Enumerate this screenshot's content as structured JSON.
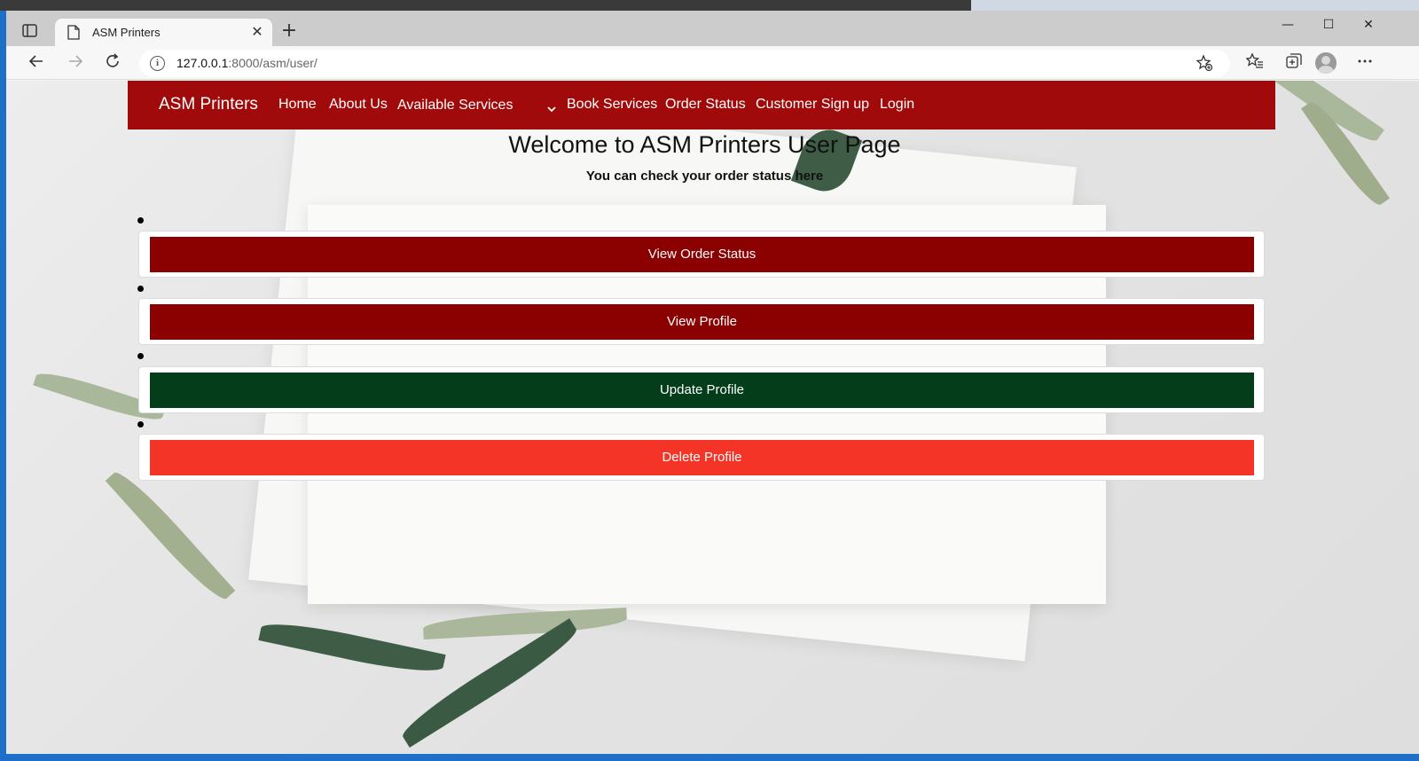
{
  "browser": {
    "tab_title": "ASM Printers",
    "tab_close": "✕",
    "new_tab": "+",
    "url_host": "127.0.0.1",
    "url_rest": ":8000/asm/user/",
    "minimize": "—",
    "maximize": "☐",
    "close": "✕"
  },
  "navbar": {
    "brand": "ASM Printers",
    "links": [
      "Home",
      "About Us",
      "Available Services",
      "Book Services",
      "Order Status",
      "Customer Sign up",
      "Login"
    ],
    "color": "#a10a0a"
  },
  "page": {
    "heading": "Welcome to ASM Printers User Page",
    "subheading": "You can check your order status here"
  },
  "actions": [
    {
      "label": "View Order Status",
      "color": "#8b0000"
    },
    {
      "label": "View Profile",
      "color": "#8b0000"
    },
    {
      "label": "Update Profile",
      "color": "#033d19"
    },
    {
      "label": "Delete Profile",
      "color": "#f33426"
    }
  ]
}
